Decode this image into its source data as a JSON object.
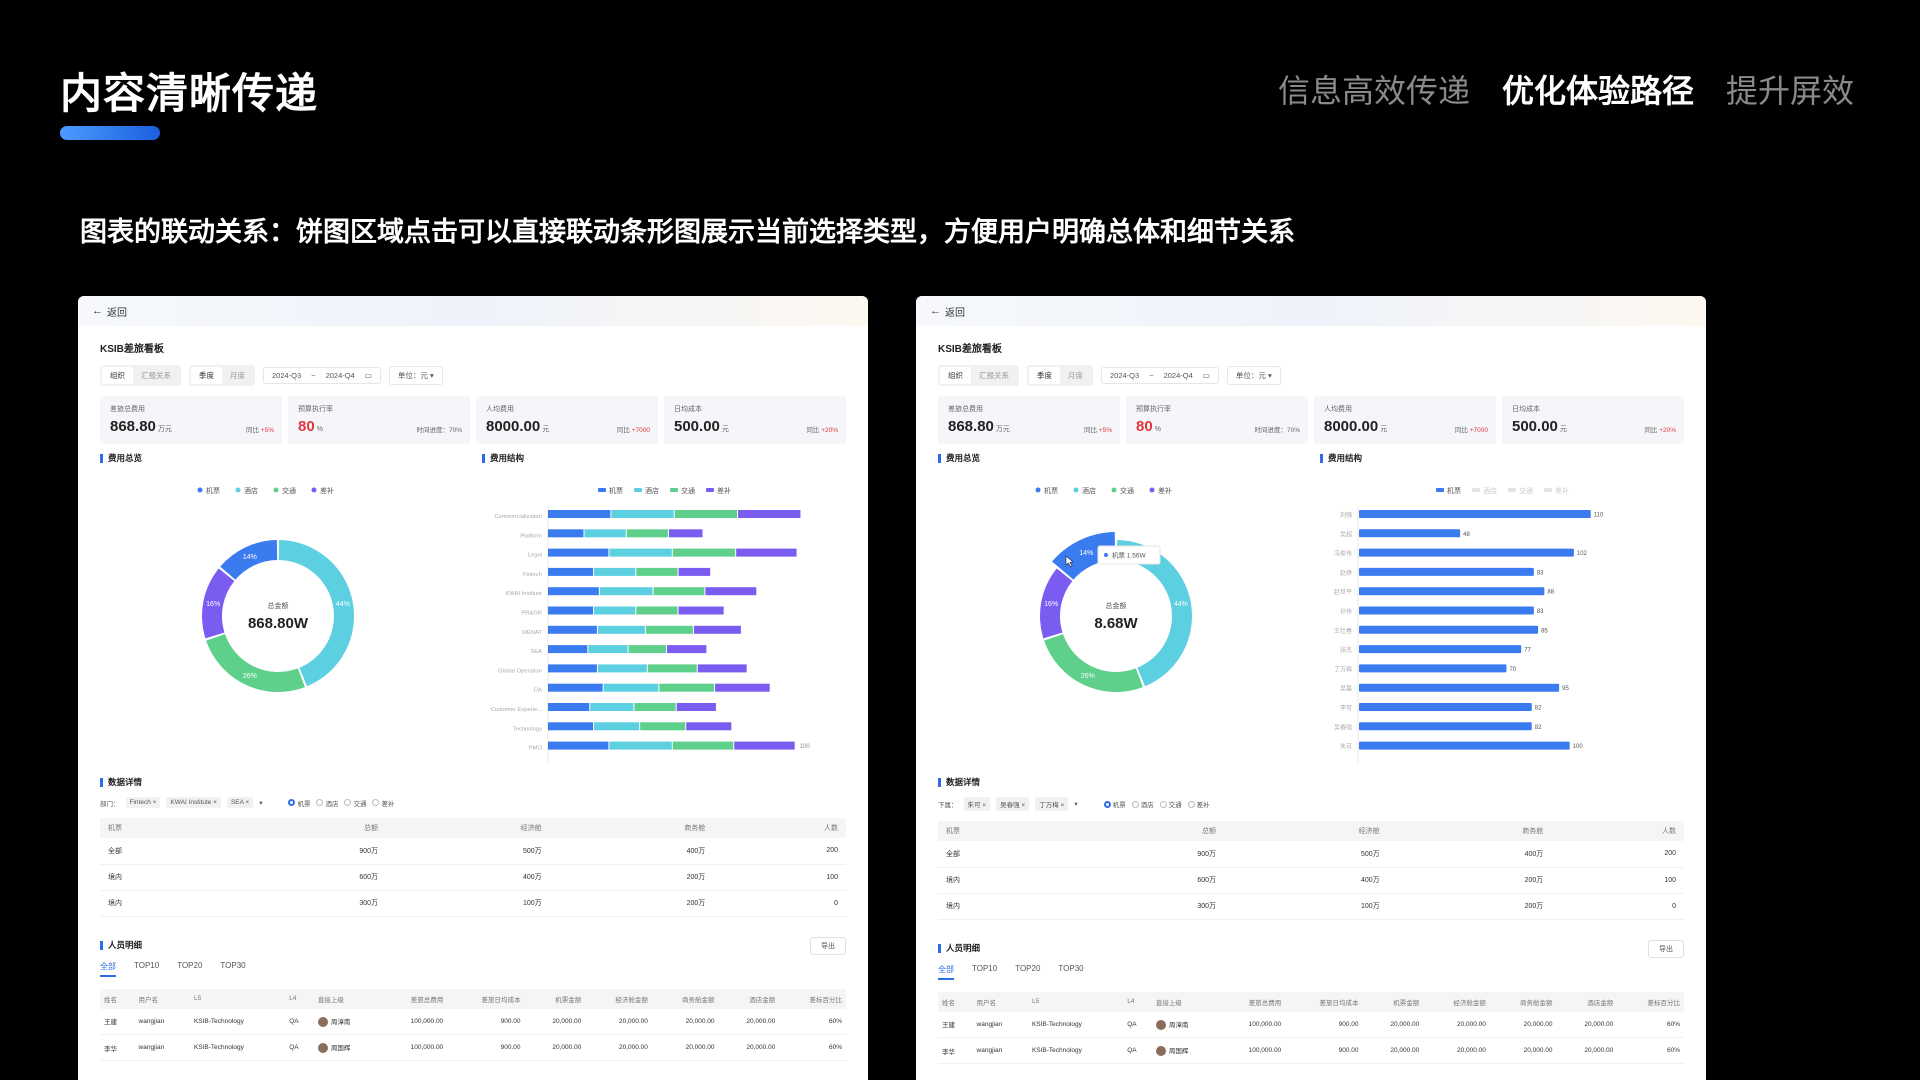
{
  "header": {
    "title": "内容清晰传递",
    "nav": [
      "信息高效传递",
      "优化体验路径",
      "提升屏效"
    ],
    "caption": "图表的联动关系：饼图区域点击可以直接联动条形图展示当前选择类型，方便用户明确总体和细节关系"
  },
  "colors": {
    "flight": "#3b7bf0",
    "hotel": "#5ccfe0",
    "traffic": "#5fcf8c",
    "allowance": "#7b5cf0"
  },
  "panels": [
    {
      "back": "返回",
      "board_title": "KSIB差旅看板",
      "seg1": [
        "组织",
        "汇报关系"
      ],
      "seg2": [
        "季度",
        "月度"
      ],
      "date_from": "2024-Q3",
      "date_sep": "~",
      "date_to": "2024-Q4",
      "unit": "单位：元",
      "kpis": [
        {
          "label": "差旅总费用",
          "value": "868.80",
          "unit": "万元",
          "compare": "同比",
          "delta": "+5%"
        },
        {
          "label": "预算执行率",
          "value": "80",
          "unit": "%",
          "compare": "时间进度：70%",
          "delta": ""
        },
        {
          "label": "人均费用",
          "value": "8000.00",
          "unit": "元",
          "compare": "同比",
          "delta": "+7000"
        },
        {
          "label": "日均成本",
          "value": "500.00",
          "unit": "元",
          "compare": "同比",
          "delta": "+20%"
        }
      ],
      "sec_overview": "费用总览",
      "sec_structure": "费用结构",
      "legend": [
        "机票",
        "酒店",
        "交通",
        "差补"
      ],
      "donut_center_label": "总金额",
      "donut_center_value": "868.80W",
      "sec_detail": "数据详情",
      "filter_label": "部门：",
      "filter_tags": [
        "Fintech ×",
        "KWAI Institute ×",
        "SEA ×"
      ],
      "radios": [
        "机票",
        "酒店",
        "交通",
        "差补"
      ],
      "detail_headers": [
        "机票",
        "总额",
        "经济舱",
        "商务舱",
        "人数"
      ],
      "detail_rows": [
        [
          "全部",
          "900万",
          "500万",
          "400万",
          "200"
        ],
        [
          "境内",
          "600万",
          "400万",
          "200万",
          "100"
        ],
        [
          "境内",
          "300万",
          "100万",
          "200万",
          "0"
        ]
      ],
      "sec_people": "人员明细",
      "export": "导出",
      "people_tabs": [
        "全部",
        "TOP10",
        "TOP20",
        "TOP30"
      ],
      "people_headers": [
        "姓名",
        "用户名",
        "L5",
        "L4",
        "直接上级",
        "差旅总费用",
        "差旅日均成本",
        "机票金额",
        "经济舱金额",
        "商务舱金额",
        "酒店金额",
        "差标百分比"
      ],
      "people_rows": [
        [
          "王建",
          "wangjian",
          "KSIB-Technology",
          "QA",
          "周漳南",
          "100,000.00",
          "900.00",
          "20,000.00",
          "20,000.00",
          "20,000.00",
          "20,000.00",
          "60%"
        ],
        [
          "李华",
          "wangjian",
          "KSIB-Technology",
          "QA",
          "周国辉",
          "100,000.00",
          "900.00",
          "20,000.00",
          "20,000.00",
          "20,000.00",
          "20,000.00",
          "60%"
        ]
      ]
    },
    {
      "back": "返回",
      "board_title": "KSIB差旅看板",
      "seg1": [
        "组织",
        "汇报关系"
      ],
      "seg2": [
        "季度",
        "月度"
      ],
      "date_from": "2024-Q3",
      "date_sep": "~",
      "date_to": "2024-Q4",
      "unit": "单位：元",
      "kpis": [
        {
          "label": "差旅总费用",
          "value": "868.80",
          "unit": "万元",
          "compare": "同比",
          "delta": "+5%"
        },
        {
          "label": "预算执行率",
          "value": "80",
          "unit": "%",
          "compare": "时间进度：70%",
          "delta": ""
        },
        {
          "label": "人均费用",
          "value": "8000.00",
          "unit": "元",
          "compare": "同比",
          "delta": "+7000"
        },
        {
          "label": "日均成本",
          "value": "500.00",
          "unit": "元",
          "compare": "同比",
          "delta": "+20%"
        }
      ],
      "sec_overview": "费用总览",
      "sec_structure": "费用结构",
      "legend": [
        "机票",
        "酒店",
        "交通",
        "差补"
      ],
      "donut_center_label": "总金额",
      "donut_center_value": "8.68W",
      "tooltip": "机票  1.56W",
      "sec_detail": "数据详情",
      "filter_label": "下属：",
      "filter_tags": [
        "朱可 ×",
        "吴春强 ×",
        "丁万梅 ×"
      ],
      "radios": [
        "机票",
        "酒店",
        "交通",
        "差补"
      ],
      "detail_headers": [
        "机票",
        "总额",
        "经济舱",
        "商务舱",
        "人数"
      ],
      "detail_rows": [
        [
          "全部",
          "900万",
          "500万",
          "400万",
          "200"
        ],
        [
          "境内",
          "600万",
          "400万",
          "200万",
          "100"
        ],
        [
          "境内",
          "300万",
          "100万",
          "200万",
          "0"
        ]
      ],
      "sec_people": "人员明细",
      "export": "导出",
      "people_tabs": [
        "全部",
        "TOP10",
        "TOP20",
        "TOP30"
      ],
      "people_headers": [
        "姓名",
        "用户名",
        "L5",
        "L4",
        "直接上级",
        "差旅总费用",
        "差旅日均成本",
        "机票金额",
        "经济舱金额",
        "商务舱金额",
        "酒店金额",
        "差标百分比"
      ],
      "people_rows": [
        [
          "王建",
          "wangjian",
          "KSIB-Technology",
          "QA",
          "周漳南",
          "100,000.00",
          "900.00",
          "20,000.00",
          "20,000.00",
          "20,000.00",
          "20,000.00",
          "60%"
        ],
        [
          "李华",
          "wangjian",
          "KSIB-Technology",
          "QA",
          "周国辉",
          "100,000.00",
          "900.00",
          "20,000.00",
          "20,000.00",
          "20,000.00",
          "20,000.00",
          "60%"
        ]
      ]
    }
  ],
  "chart_data": [
    {
      "type": "pie",
      "panel": "left",
      "categories": [
        "机票",
        "酒店",
        "交通",
        "差补"
      ],
      "values": [
        14,
        44,
        26,
        16
      ],
      "labels": [
        "14%",
        "44%",
        "26%",
        "16%"
      ]
    },
    {
      "type": "bar",
      "panel": "left",
      "orientation": "horizontal",
      "stacked": true,
      "categories": [
        "Commercialization",
        "Platform",
        "Legal",
        "Fintech",
        "KWAI Institute",
        "PR&GR",
        "MENAT",
        "SEA",
        "Global Operation",
        "DA",
        "Customer Experie...",
        "Technology",
        "PMO"
      ],
      "series": [
        {
          "name": "机票",
          "values": [
            33,
            19,
            32,
            24,
            27,
            24,
            26,
            21,
            26,
            29,
            22,
            24,
            32
          ]
        },
        {
          "name": "酒店",
          "values": [
            33,
            22,
            33,
            22,
            28,
            22,
            25,
            21,
            26,
            29,
            23,
            24,
            33
          ]
        },
        {
          "name": "交通",
          "values": [
            33,
            22,
            33,
            22,
            27,
            22,
            25,
            20,
            26,
            29,
            22,
            24,
            32
          ]
        },
        {
          "name": "差补",
          "values": [
            33,
            18,
            32,
            17,
            27,
            24,
            25,
            21,
            26,
            29,
            21,
            24,
            32
          ]
        }
      ],
      "totals_labeled": {
        "PMO": "100"
      },
      "xticks": [
        0,
        40,
        80,
        120,
        150
      ],
      "xlim": [
        0,
        150
      ]
    },
    {
      "type": "pie",
      "panel": "right",
      "categories": [
        "机票",
        "酒店",
        "交通",
        "差补"
      ],
      "values": [
        14,
        44,
        26,
        16
      ],
      "labels": [
        "14%",
        "44%",
        "26%",
        "16%"
      ],
      "highlighted": "机票"
    },
    {
      "type": "bar",
      "panel": "right",
      "orientation": "horizontal",
      "series_name": "机票",
      "categories": [
        "刘强",
        "吴超",
        "冯俊伟",
        "赵婷",
        "赵世平",
        "孙伟",
        "王壮春",
        "张杰",
        "丁万梅",
        "吴磊",
        "李可",
        "吴春强",
        "朱可"
      ],
      "values": [
        110,
        48,
        102,
        83,
        88,
        83,
        85,
        77,
        70,
        95,
        82,
        82,
        100
      ],
      "xticks": [
        0,
        20,
        50,
        100,
        150
      ],
      "xlim": [
        0,
        150
      ]
    }
  ]
}
